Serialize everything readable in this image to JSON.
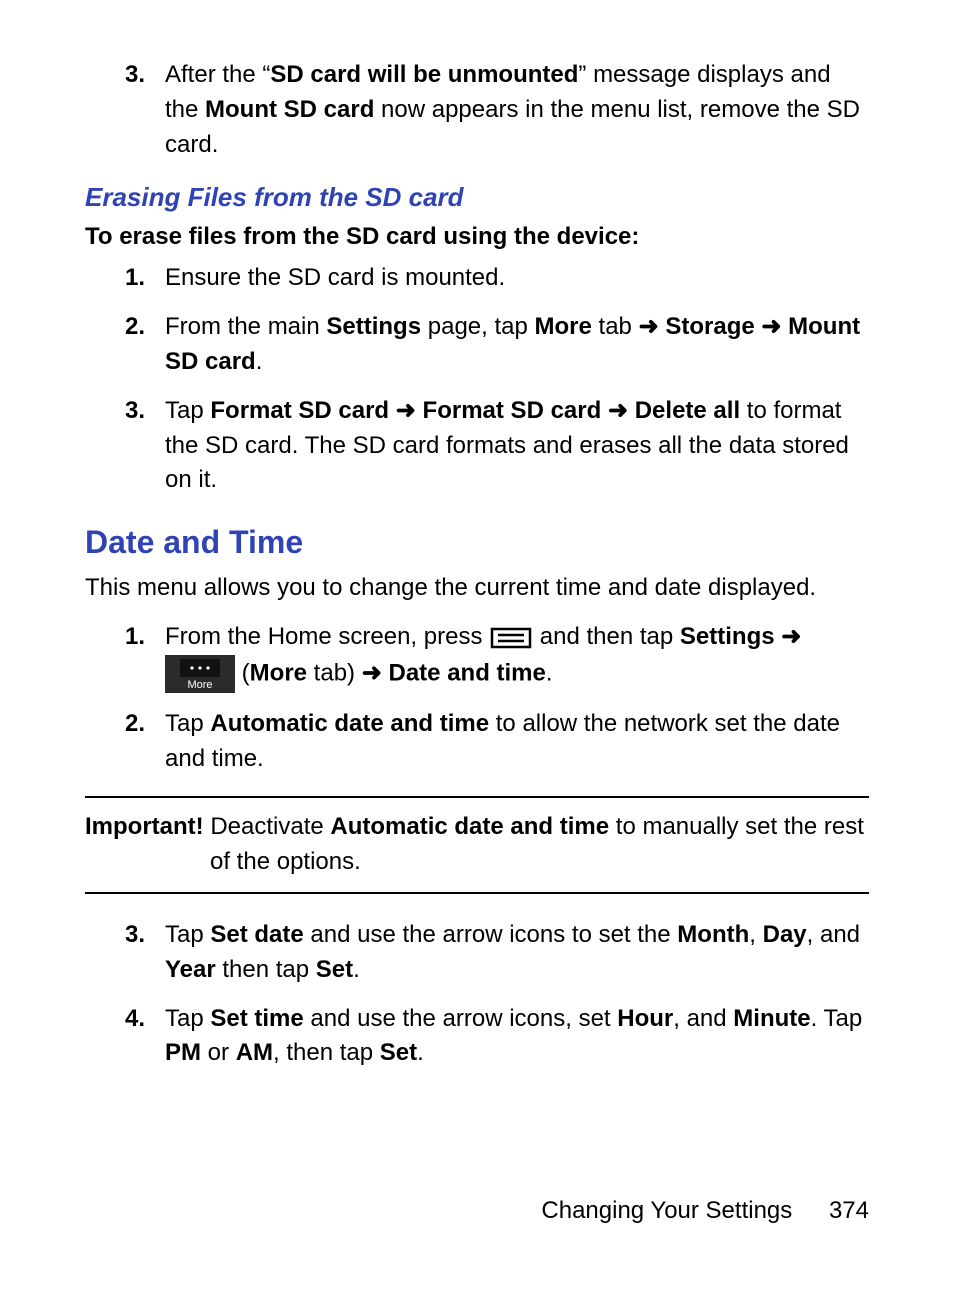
{
  "step3_top": {
    "num": "3.",
    "pre": "After the “",
    "b1": "SD card will be unmounted",
    "mid": "” message displays and the ",
    "b2": "Mount SD card",
    "post": " now appears in the menu list, remove the SD card."
  },
  "erase": {
    "heading": "Erasing Files from the SD card",
    "intro": "To erase files from the SD card using the device:",
    "s1": {
      "num": "1.",
      "text": "Ensure the SD card is mounted."
    },
    "s2": {
      "num": "2.",
      "a": "From the main ",
      "b_settings": "Settings",
      "c": " page, tap ",
      "b_more": "More",
      "d": " tab ",
      "arrow1": "➜",
      "sp1": " ",
      "b_storage": "Storage",
      "sp2": " ",
      "arrow2": "➜",
      "sp3": " ",
      "b_mount": "Mount SD card",
      "dot": "."
    },
    "s3": {
      "num": "3.",
      "a": "Tap ",
      "b_f1": "Format SD card",
      "sp1": " ",
      "arr1": "➜",
      "sp2": " ",
      "b_f2": "Format SD card",
      "sp3": " ",
      "arr2": "➜",
      "sp4": "  ",
      "b_del": "Delete all",
      "tail": " to format the SD card. The SD card formats and erases all the data stored on it."
    }
  },
  "date": {
    "heading": "Date and Time",
    "intro": "This menu allows you to change the current time and date displayed.",
    "s1": {
      "num": "1.",
      "a": "From the Home screen, press ",
      "mid": " and then tap ",
      "b_settings": "Settings",
      "sp1": " ",
      "arr1": "➜",
      "sp2": " ",
      "paren_open": " (",
      "b_more": "More",
      "paren_mid": " tab) ",
      "arr2": "➜",
      "sp3": " ",
      "b_dt": "Date and time",
      "dot": "."
    },
    "s2": {
      "num": "2.",
      "a": "Tap ",
      "b_auto": "Automatic date and time",
      "tail": " to allow the network set the date and time."
    },
    "important": {
      "label": "Important! ",
      "a": "Deactivate ",
      "b_auto": "Automatic date and time",
      "tail": " to manually set the rest of the options."
    },
    "s3": {
      "num": "3.",
      "a": "Tap ",
      "b_setdate": "Set date",
      "b": " and use the arrow icons to set the ",
      "b_month": "Month",
      "c1": ", ",
      "b_day": "Day",
      "c2": ", and ",
      "b_year": "Year",
      "d": " then tap ",
      "b_set": "Set",
      "dot": "."
    },
    "s4": {
      "num": "4.",
      "a": "Tap ",
      "b_settime": "Set time",
      "b": " and use the arrow icons, set ",
      "b_hour": "Hour",
      "c1": ", and ",
      "b_minute": "Minute",
      "d": ". Tap ",
      "b_pm": "PM",
      "e": " or ",
      "b_am": "AM",
      "f": ", then tap ",
      "b_set": "Set",
      "dot": "."
    }
  },
  "footer": {
    "section": "Changing Your Settings",
    "page": "374"
  },
  "icons": {
    "menu": "menu-icon",
    "more": "More"
  }
}
